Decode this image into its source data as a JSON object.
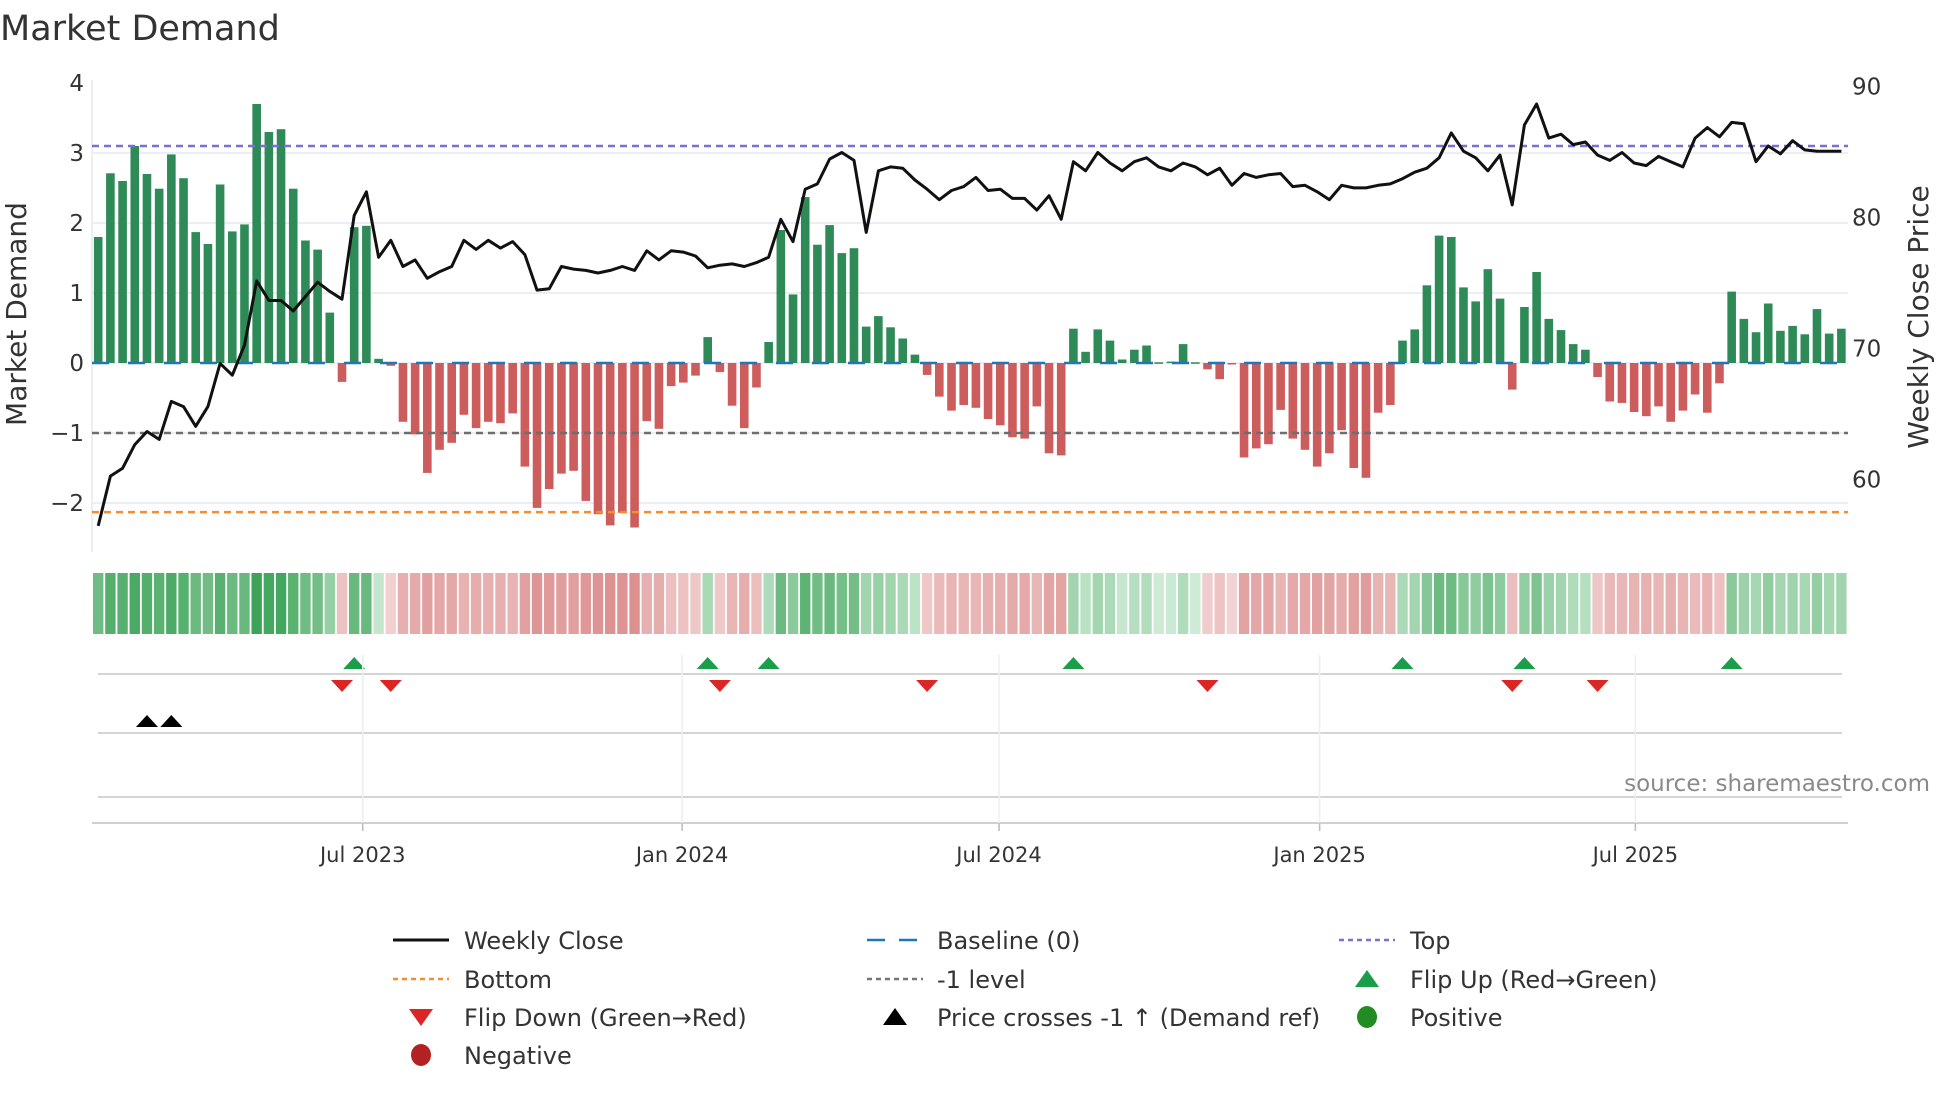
{
  "chart_data": {
    "type": "bar",
    "title": "Market Demand",
    "ylabel": "Market Demand",
    "y2label": "Weekly Close Price",
    "ylim": [
      -2.5,
      4.1
    ],
    "y2lim": [
      56,
      90.5
    ],
    "yticks": [
      "4",
      "3",
      "2",
      "1",
      "0",
      "−1",
      "−2"
    ],
    "ytick_values": [
      4,
      3,
      2,
      1,
      0,
      -1,
      -2
    ],
    "y2ticks": [
      "90",
      "80",
      "70",
      "60"
    ],
    "y2tick_values": [
      90,
      80,
      70,
      60
    ],
    "x_unit": "week index (1-144)",
    "xticks": [
      {
        "label": "Jul 2023",
        "week": 22.7
      },
      {
        "label": "Jan 2024",
        "week": 48.9
      },
      {
        "label": "Jul 2024",
        "week": 74.9
      },
      {
        "label": "Jan 2025",
        "week": 101.2
      },
      {
        "label": "Jul 2025",
        "week": 127.1
      }
    ],
    "reference_lines": {
      "top": 3.1,
      "bottom": -2.13,
      "minus_one": -1,
      "baseline": 0
    },
    "demand": [
      1.8,
      2.71,
      2.6,
      3.1,
      2.7,
      2.49,
      2.98,
      2.64,
      1.87,
      1.7,
      2.55,
      1.88,
      1.98,
      3.7,
      3.3,
      3.34,
      2.49,
      1.75,
      1.62,
      0.72,
      -0.27,
      1.94,
      1.96,
      0.06,
      -0.04,
      -0.84,
      -1.02,
      -1.57,
      -1.24,
      -1.14,
      -0.74,
      -0.93,
      -0.84,
      -0.86,
      -0.72,
      -1.48,
      -2.07,
      -1.8,
      -1.58,
      -1.54,
      -1.97,
      -2.16,
      -2.32,
      -2.14,
      -2.35,
      -0.83,
      -0.94,
      -0.33,
      -0.28,
      -0.18,
      0.37,
      -0.13,
      -0.61,
      -0.93,
      -0.35,
      0.3,
      1.9,
      0.98,
      2.37,
      1.69,
      1.97,
      1.57,
      1.64,
      0.52,
      0.67,
      0.51,
      0.35,
      0.12,
      -0.17,
      -0.48,
      -0.68,
      -0.6,
      -0.64,
      -0.8,
      -0.89,
      -1.06,
      -1.08,
      -0.62,
      -1.29,
      -1.32,
      0.49,
      0.16,
      0.48,
      0.32,
      0.05,
      0.19,
      0.25,
      0.01,
      0.02,
      0.27,
      0.01,
      -0.09,
      -0.23,
      -0.02,
      -1.35,
      -1.22,
      -1.16,
      -0.67,
      -1.08,
      -1.24,
      -1.48,
      -1.29,
      -0.96,
      -1.5,
      -1.64,
      -0.71,
      -0.6,
      0.32,
      0.48,
      1.11,
      1.82,
      1.8,
      1.08,
      0.88,
      1.34,
      0.92,
      -0.38,
      0.8,
      1.3,
      0.63,
      0.47,
      0.27,
      0.19,
      -0.2,
      -0.55,
      -0.57,
      -0.7,
      -0.76,
      -0.62,
      -0.84,
      -0.68,
      -0.45,
      -0.71,
      -0.29,
      1.02,
      0.63,
      0.44,
      0.85,
      0.46,
      0.53,
      0.41,
      0.77,
      0.42,
      0.49
    ],
    "weekly_close": [
      56.4,
      60.2,
      60.8,
      62.6,
      63.6,
      63.0,
      65.9,
      65.5,
      64.0,
      65.5,
      68.8,
      67.9,
      70.2,
      75.1,
      73.6,
      73.6,
      72.8,
      73.9,
      75.0,
      74.3,
      73.7,
      80.1,
      81.9,
      76.9,
      78.2,
      76.2,
      76.7,
      75.3,
      75.8,
      76.2,
      78.2,
      77.5,
      78.2,
      77.6,
      78.1,
      77.1,
      74.4,
      74.5,
      76.2,
      76.0,
      75.9,
      75.7,
      75.9,
      76.2,
      75.9,
      77.4,
      76.7,
      77.4,
      77.3,
      77.0,
      76.1,
      76.3,
      76.4,
      76.2,
      76.5,
      76.9,
      79.8,
      78.1,
      82.1,
      82.5,
      84.4,
      84.9,
      84.3,
      78.8,
      83.5,
      83.8,
      83.7,
      82.8,
      82.1,
      81.3,
      82.0,
      82.3,
      83.0,
      82.0,
      82.1,
      81.4,
      81.4,
      80.5,
      81.6,
      79.8,
      84.2,
      83.5,
      84.9,
      84.1,
      83.5,
      84.2,
      84.5,
      83.8,
      83.5,
      84.1,
      83.8,
      83.2,
      83.7,
      82.4,
      83.3,
      83.0,
      83.2,
      83.3,
      82.3,
      82.4,
      81.9,
      81.3,
      82.4,
      82.2,
      82.2,
      82.4,
      82.5,
      82.9,
      83.4,
      83.7,
      84.5,
      86.4,
      85.0,
      84.5,
      83.5,
      84.7,
      80.9,
      87.0,
      88.6,
      86.0,
      86.3,
      85.5,
      85.7,
      84.7,
      84.3,
      84.9,
      84.1,
      83.9,
      84.6,
      84.2,
      83.8,
      86.0,
      86.8,
      86.1,
      87.2,
      87.1,
      84.2,
      85.4,
      84.8,
      85.8,
      85.1,
      85.0,
      85.0,
      85.0
    ],
    "flip_up_weeks": [
      22,
      51,
      56,
      81,
      108,
      118,
      135
    ],
    "flip_down_weeks": [
      21,
      25,
      52,
      69,
      92,
      117,
      124
    ],
    "price_cross_weeks": [
      5,
      7
    ],
    "legend_placement": "bottom-center",
    "legend": [
      {
        "label": "Weekly Close",
        "symbol": "solid-line",
        "color": "#111111"
      },
      {
        "label": "Baseline (0)",
        "symbol": "dashed-line",
        "color": "#1f77b4"
      },
      {
        "label": "Top",
        "symbol": "dotted-line",
        "color": "#7b6fd6"
      },
      {
        "label": "Bottom",
        "symbol": "dotted-line",
        "color": "#f28e2b"
      },
      {
        "label": "-1 level",
        "symbol": "dotted-line",
        "color": "#777777"
      },
      {
        "label": "Flip Up (Red→Green)",
        "symbol": "triangle-up",
        "color": "#1a9e4a"
      },
      {
        "label": "Flip Down (Green→Red)",
        "symbol": "triangle-down",
        "color": "#dc2626"
      },
      {
        "label": "Price crosses -1 ↑ (Demand ref)",
        "symbol": "triangle-up",
        "color": "#000000"
      },
      {
        "label": "Positive",
        "symbol": "circle",
        "color": "#228b22"
      },
      {
        "label": "Negative",
        "symbol": "circle",
        "color": "#b22222"
      }
    ],
    "colors": {
      "positive_bar": "#2e8b57",
      "negative_bar": "#cd5c5c",
      "grid": "#eceef3"
    }
  },
  "source": "source: sharemaestro.com"
}
